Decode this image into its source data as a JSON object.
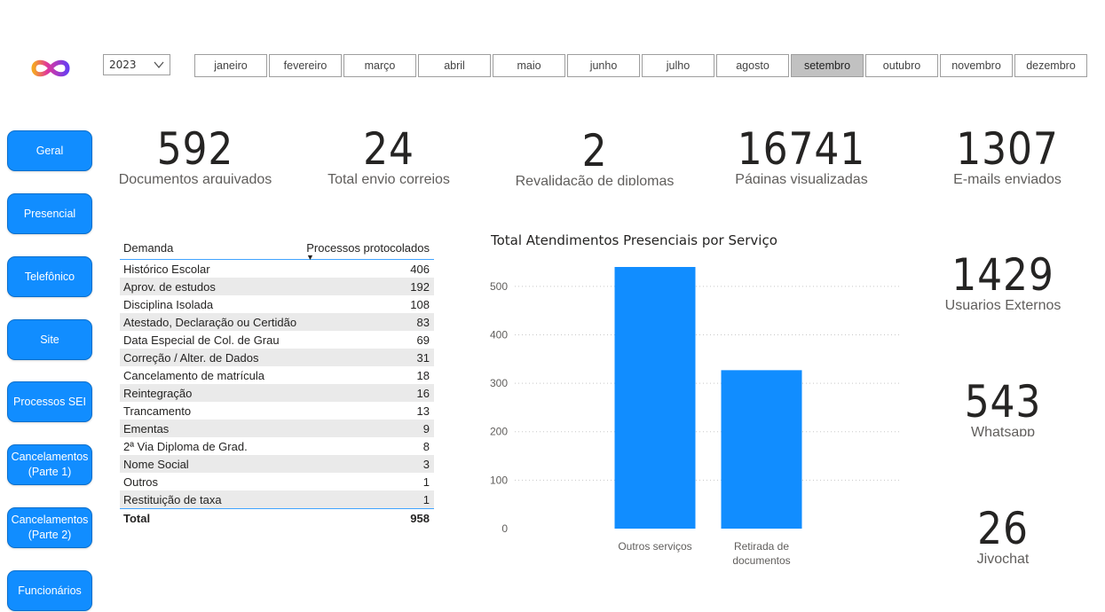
{
  "header": {
    "year": "2023",
    "months": [
      "janeiro",
      "fevereiro",
      "março",
      "abril",
      "maio",
      "junho",
      "julho",
      "agosto",
      "setembro",
      "outubro",
      "novembro",
      "dezembro"
    ],
    "active_month": "setembro"
  },
  "nav": [
    {
      "label": "Geral"
    },
    {
      "label": "Presencial"
    },
    {
      "label": "Telefônico"
    },
    {
      "label": "Site"
    },
    {
      "label": "Processos SEI"
    },
    {
      "label": "Cancelamentos (Parte 1)"
    },
    {
      "label": "Cancelamentos (Parte 2)"
    },
    {
      "label": "Funcionários"
    }
  ],
  "kpis": {
    "documentos": {
      "value": "592",
      "label": "Documentos arquivados"
    },
    "correios": {
      "value": "24",
      "label": "Total envio correios"
    },
    "revalidacao": {
      "value": "2",
      "label": "Revalidação de diplomas"
    },
    "paginas": {
      "value": "16741",
      "label": "Páginas visualizadas"
    },
    "emails": {
      "value": "1307",
      "label": "E-mails enviados"
    },
    "usuarios": {
      "value": "1429",
      "label": "Usuarios Externos"
    },
    "whatsapp": {
      "value": "543",
      "label": "Whatsapp"
    },
    "jivochat": {
      "value": "26",
      "label": "Jivochat"
    }
  },
  "table": {
    "col1": "Demanda",
    "col2": "Processos protocolados",
    "rows": [
      {
        "name": "Histórico Escolar",
        "value": "406"
      },
      {
        "name": "Aprov. de estudos",
        "value": "192"
      },
      {
        "name": "Disciplina Isolada",
        "value": "108"
      },
      {
        "name": "Atestado, Declaração ou Certidão",
        "value": "83"
      },
      {
        "name": "Data Especial de Col. de Grau",
        "value": "69"
      },
      {
        "name": "Correção / Alter. de Dados",
        "value": "31"
      },
      {
        "name": "Cancelamento de matrícula",
        "value": "18"
      },
      {
        "name": "Reintegração",
        "value": "16"
      },
      {
        "name": "Trancamento",
        "value": "13"
      },
      {
        "name": "Ementas",
        "value": "9"
      },
      {
        "name": "2ª Via Diploma de Grad.",
        "value": "8"
      },
      {
        "name": "Nome Social",
        "value": "3"
      },
      {
        "name": "Outros",
        "value": "1"
      },
      {
        "name": "Restituição de taxa",
        "value": "1"
      }
    ],
    "total_label": "Total",
    "total_value": "958"
  },
  "chart_data": {
    "type": "bar",
    "title": "Total Atendimentos Presenciais por Serviço",
    "categories": [
      "Outros serviços",
      "Retirada de documentos"
    ],
    "category_lines": [
      [
        "Outros serviços"
      ],
      [
        "Retirada de",
        "documentos"
      ]
    ],
    "values": [
      540,
      327
    ],
    "yticks": [
      0,
      100,
      200,
      300,
      400,
      500
    ],
    "ylim": [
      0,
      550
    ],
    "grid": true,
    "bar_color": "#118DFF"
  },
  "colors": {
    "accent": "#118DFF",
    "active_month": "#c1c1c1"
  }
}
